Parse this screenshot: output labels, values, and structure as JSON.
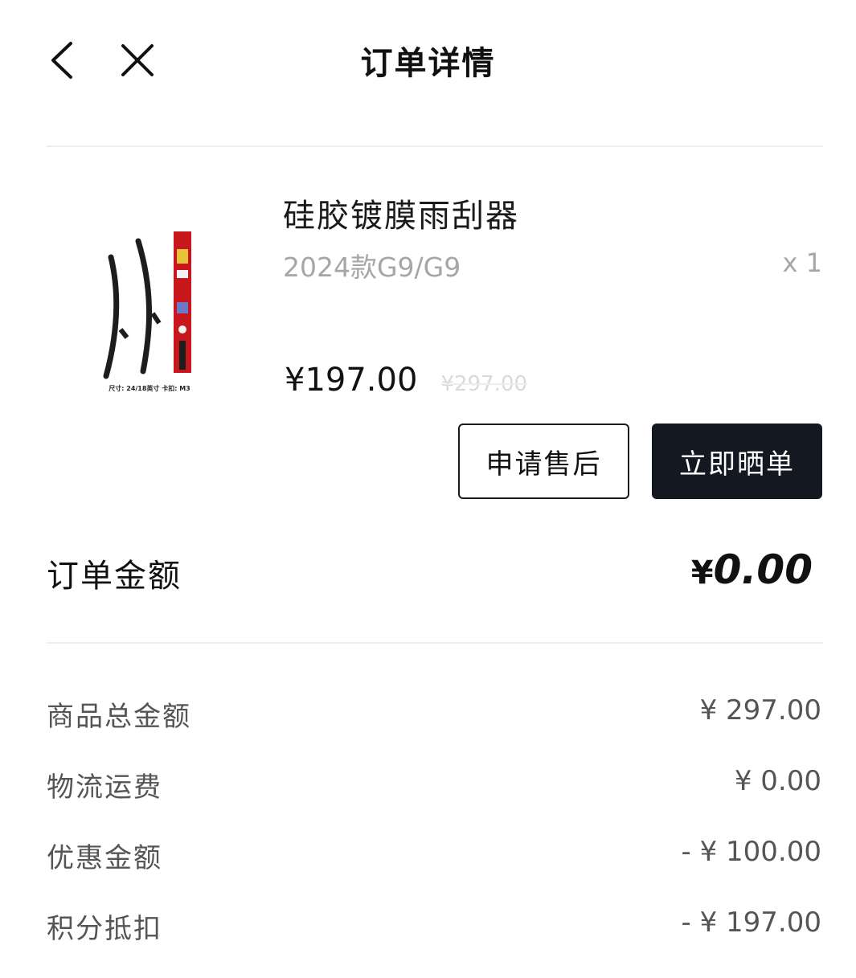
{
  "header": {
    "title": "订单详情",
    "back_icon": "chevron-left-icon",
    "close_icon": "close-icon"
  },
  "product": {
    "name": "硅胶镀膜雨刮器",
    "variant": "2024款G9/G9",
    "quantity": "x 1",
    "price": "¥197.00",
    "original_price": "¥297.00",
    "image_caption": "尺寸: 24/18英寸  卡扣: M3"
  },
  "actions": {
    "after_sale_label": "申请售后",
    "review_label": "立即晒单"
  },
  "order_amount": {
    "label": "订单金额",
    "currency": "¥",
    "value": "0.00"
  },
  "summary": [
    {
      "label": "商品总金额",
      "value": "¥ 297.00"
    },
    {
      "label": "物流运费",
      "value": "¥ 0.00"
    },
    {
      "label": "优惠金额",
      "value": "- ¥ 100.00"
    },
    {
      "label": "积分抵扣",
      "value": "- ¥ 197.00"
    }
  ],
  "colors": {
    "primary_button": "#141821",
    "muted_text": "#a6a6a6",
    "divider": "#eeeeee"
  }
}
